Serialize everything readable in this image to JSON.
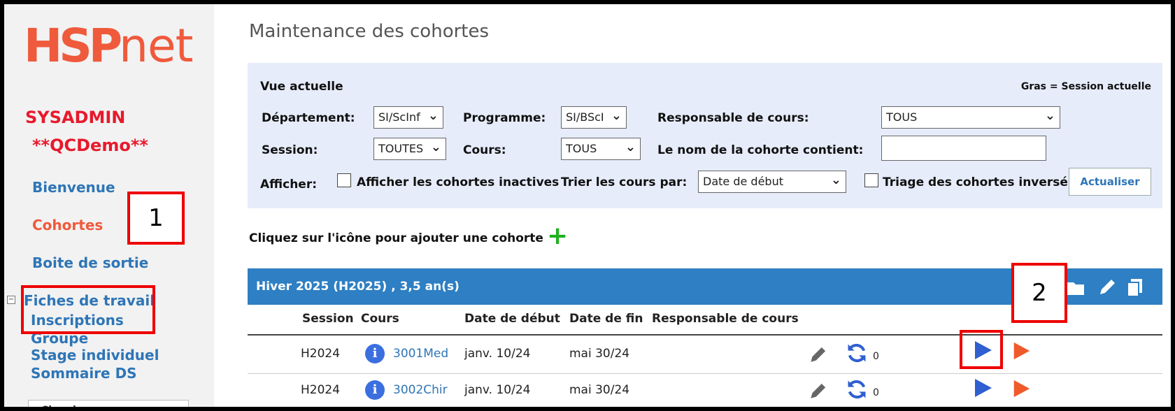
{
  "logo": {
    "hsp": "HSP",
    "net": "net"
  },
  "sidebar": {
    "user": "SYSADMIN",
    "site": "**QCDemo**",
    "items": [
      {
        "label": "Bienvenue"
      },
      {
        "label": "Cohortes"
      },
      {
        "label": "Boite de sortie"
      },
      {
        "label": "Fiches de travail"
      },
      {
        "label": "Inscriptions"
      },
      {
        "label": "Groupe"
      },
      {
        "label": "Stage individuel"
      },
      {
        "label": "Sommaire DS"
      }
    ],
    "search_label": "Chercher:"
  },
  "annotations": {
    "one": "1",
    "two": "2"
  },
  "page_title": "Maintenance des cohortes",
  "filters": {
    "current_view": "Vue actuelle",
    "bold_note": "Gras = Session actuelle",
    "department_label": "Département:",
    "department_value": "SI/ScInf",
    "program_label": "Programme:",
    "program_value": "SI/BScI",
    "course_lead_label": "Responsable de cours:",
    "course_lead_value": "TOUS",
    "session_label": "Session:",
    "session_value": "TOUTES",
    "course_label": "Cours:",
    "course_value": "TOUS",
    "name_contains_label": "Le nom de la cohorte contient:",
    "name_contains_value": "",
    "show_label": "Afficher:",
    "show_inactive_label": "Afficher les cohortes inactives",
    "sort_label": "Trier les cours par:",
    "sort_value": "Date de début",
    "reverse_label": "Triage des cohortes inversé",
    "refresh_button": "Actualiser"
  },
  "add_hint": "Cliquez sur l'icône pour ajouter une cohorte",
  "cohort": {
    "title": "Hiver 2025 (H2025) , 3,5 an(s)",
    "columns": [
      "Session",
      "Cours",
      "Date de début",
      "Date de fin",
      "Responsable de cours"
    ],
    "rows": [
      {
        "session": "H2024",
        "course": "3001Med",
        "start": "janv. 10/24",
        "end": "mai 30/24",
        "lead": "",
        "count": "0"
      },
      {
        "session": "H2024",
        "course": "3002Chir",
        "start": "janv. 10/24",
        "end": "mai 30/24",
        "lead": "",
        "count": "0"
      }
    ]
  },
  "colors": {
    "accent": "#2e7fc3",
    "logo": "#ef5a3c",
    "alert": "#e8192c",
    "link": "#2e75b6",
    "play_blue": "#2f5fd0",
    "play_orange": "#f05a2a"
  }
}
